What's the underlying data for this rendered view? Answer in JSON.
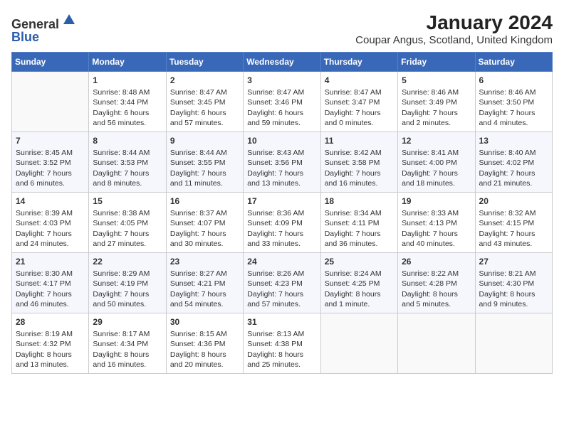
{
  "header": {
    "logo_line1": "General",
    "logo_line2": "Blue",
    "title": "January 2024",
    "subtitle": "Coupar Angus, Scotland, United Kingdom"
  },
  "columns": [
    "Sunday",
    "Monday",
    "Tuesday",
    "Wednesday",
    "Thursday",
    "Friday",
    "Saturday"
  ],
  "weeks": [
    [
      {
        "day": "",
        "sunrise": "",
        "sunset": "",
        "daylight": ""
      },
      {
        "day": "1",
        "sunrise": "Sunrise: 8:48 AM",
        "sunset": "Sunset: 3:44 PM",
        "daylight": "Daylight: 6 hours and 56 minutes."
      },
      {
        "day": "2",
        "sunrise": "Sunrise: 8:47 AM",
        "sunset": "Sunset: 3:45 PM",
        "daylight": "Daylight: 6 hours and 57 minutes."
      },
      {
        "day": "3",
        "sunrise": "Sunrise: 8:47 AM",
        "sunset": "Sunset: 3:46 PM",
        "daylight": "Daylight: 6 hours and 59 minutes."
      },
      {
        "day": "4",
        "sunrise": "Sunrise: 8:47 AM",
        "sunset": "Sunset: 3:47 PM",
        "daylight": "Daylight: 7 hours and 0 minutes."
      },
      {
        "day": "5",
        "sunrise": "Sunrise: 8:46 AM",
        "sunset": "Sunset: 3:49 PM",
        "daylight": "Daylight: 7 hours and 2 minutes."
      },
      {
        "day": "6",
        "sunrise": "Sunrise: 8:46 AM",
        "sunset": "Sunset: 3:50 PM",
        "daylight": "Daylight: 7 hours and 4 minutes."
      }
    ],
    [
      {
        "day": "7",
        "sunrise": "Sunrise: 8:45 AM",
        "sunset": "Sunset: 3:52 PM",
        "daylight": "Daylight: 7 hours and 6 minutes."
      },
      {
        "day": "8",
        "sunrise": "Sunrise: 8:44 AM",
        "sunset": "Sunset: 3:53 PM",
        "daylight": "Daylight: 7 hours and 8 minutes."
      },
      {
        "day": "9",
        "sunrise": "Sunrise: 8:44 AM",
        "sunset": "Sunset: 3:55 PM",
        "daylight": "Daylight: 7 hours and 11 minutes."
      },
      {
        "day": "10",
        "sunrise": "Sunrise: 8:43 AM",
        "sunset": "Sunset: 3:56 PM",
        "daylight": "Daylight: 7 hours and 13 minutes."
      },
      {
        "day": "11",
        "sunrise": "Sunrise: 8:42 AM",
        "sunset": "Sunset: 3:58 PM",
        "daylight": "Daylight: 7 hours and 16 minutes."
      },
      {
        "day": "12",
        "sunrise": "Sunrise: 8:41 AM",
        "sunset": "Sunset: 4:00 PM",
        "daylight": "Daylight: 7 hours and 18 minutes."
      },
      {
        "day": "13",
        "sunrise": "Sunrise: 8:40 AM",
        "sunset": "Sunset: 4:02 PM",
        "daylight": "Daylight: 7 hours and 21 minutes."
      }
    ],
    [
      {
        "day": "14",
        "sunrise": "Sunrise: 8:39 AM",
        "sunset": "Sunset: 4:03 PM",
        "daylight": "Daylight: 7 hours and 24 minutes."
      },
      {
        "day": "15",
        "sunrise": "Sunrise: 8:38 AM",
        "sunset": "Sunset: 4:05 PM",
        "daylight": "Daylight: 7 hours and 27 minutes."
      },
      {
        "day": "16",
        "sunrise": "Sunrise: 8:37 AM",
        "sunset": "Sunset: 4:07 PM",
        "daylight": "Daylight: 7 hours and 30 minutes."
      },
      {
        "day": "17",
        "sunrise": "Sunrise: 8:36 AM",
        "sunset": "Sunset: 4:09 PM",
        "daylight": "Daylight: 7 hours and 33 minutes."
      },
      {
        "day": "18",
        "sunrise": "Sunrise: 8:34 AM",
        "sunset": "Sunset: 4:11 PM",
        "daylight": "Daylight: 7 hours and 36 minutes."
      },
      {
        "day": "19",
        "sunrise": "Sunrise: 8:33 AM",
        "sunset": "Sunset: 4:13 PM",
        "daylight": "Daylight: 7 hours and 40 minutes."
      },
      {
        "day": "20",
        "sunrise": "Sunrise: 8:32 AM",
        "sunset": "Sunset: 4:15 PM",
        "daylight": "Daylight: 7 hours and 43 minutes."
      }
    ],
    [
      {
        "day": "21",
        "sunrise": "Sunrise: 8:30 AM",
        "sunset": "Sunset: 4:17 PM",
        "daylight": "Daylight: 7 hours and 46 minutes."
      },
      {
        "day": "22",
        "sunrise": "Sunrise: 8:29 AM",
        "sunset": "Sunset: 4:19 PM",
        "daylight": "Daylight: 7 hours and 50 minutes."
      },
      {
        "day": "23",
        "sunrise": "Sunrise: 8:27 AM",
        "sunset": "Sunset: 4:21 PM",
        "daylight": "Daylight: 7 hours and 54 minutes."
      },
      {
        "day": "24",
        "sunrise": "Sunrise: 8:26 AM",
        "sunset": "Sunset: 4:23 PM",
        "daylight": "Daylight: 7 hours and 57 minutes."
      },
      {
        "day": "25",
        "sunrise": "Sunrise: 8:24 AM",
        "sunset": "Sunset: 4:25 PM",
        "daylight": "Daylight: 8 hours and 1 minute."
      },
      {
        "day": "26",
        "sunrise": "Sunrise: 8:22 AM",
        "sunset": "Sunset: 4:28 PM",
        "daylight": "Daylight: 8 hours and 5 minutes."
      },
      {
        "day": "27",
        "sunrise": "Sunrise: 8:21 AM",
        "sunset": "Sunset: 4:30 PM",
        "daylight": "Daylight: 8 hours and 9 minutes."
      }
    ],
    [
      {
        "day": "28",
        "sunrise": "Sunrise: 8:19 AM",
        "sunset": "Sunset: 4:32 PM",
        "daylight": "Daylight: 8 hours and 13 minutes."
      },
      {
        "day": "29",
        "sunrise": "Sunrise: 8:17 AM",
        "sunset": "Sunset: 4:34 PM",
        "daylight": "Daylight: 8 hours and 16 minutes."
      },
      {
        "day": "30",
        "sunrise": "Sunrise: 8:15 AM",
        "sunset": "Sunset: 4:36 PM",
        "daylight": "Daylight: 8 hours and 20 minutes."
      },
      {
        "day": "31",
        "sunrise": "Sunrise: 8:13 AM",
        "sunset": "Sunset: 4:38 PM",
        "daylight": "Daylight: 8 hours and 25 minutes."
      },
      {
        "day": "",
        "sunrise": "",
        "sunset": "",
        "daylight": ""
      },
      {
        "day": "",
        "sunrise": "",
        "sunset": "",
        "daylight": ""
      },
      {
        "day": "",
        "sunrise": "",
        "sunset": "",
        "daylight": ""
      }
    ]
  ]
}
